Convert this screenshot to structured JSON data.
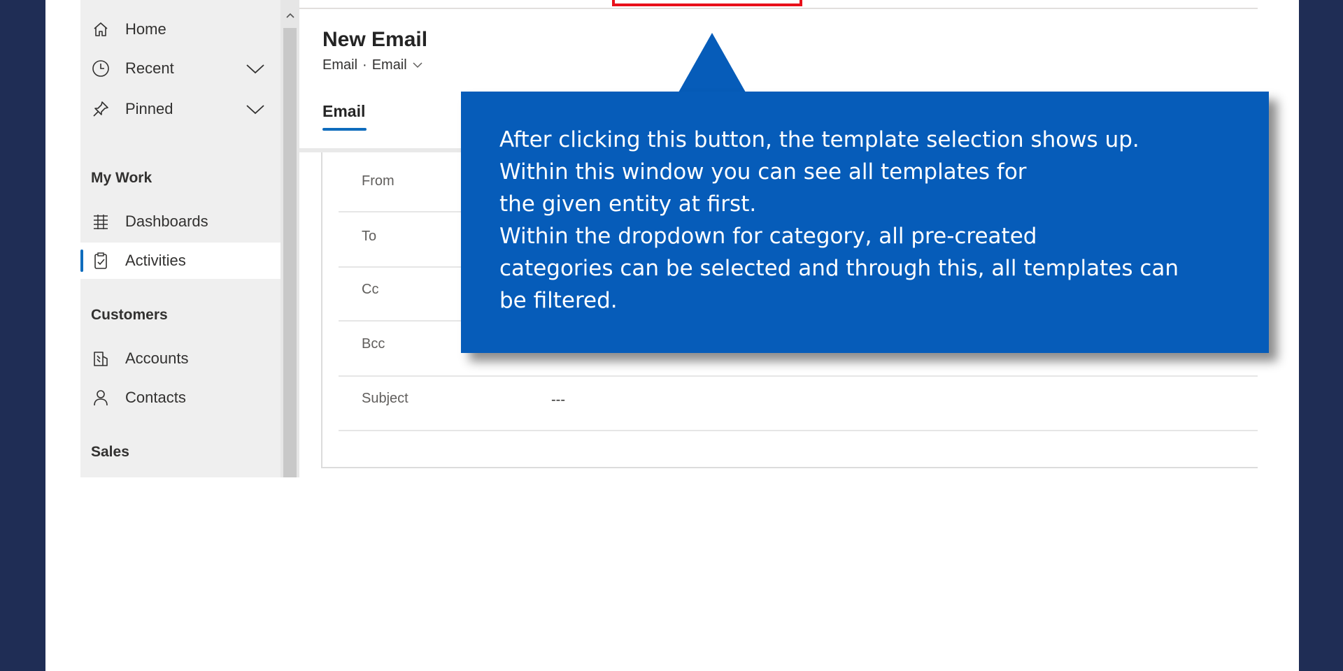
{
  "sidebar": {
    "items": [
      {
        "label": "Home",
        "icon": "home-icon"
      },
      {
        "label": "Recent",
        "icon": "clock-icon"
      },
      {
        "label": "Pinned",
        "icon": "pin-icon"
      }
    ],
    "sections": [
      {
        "title": "My Work",
        "items": [
          {
            "label": "Dashboards",
            "icon": "dashboard-icon"
          },
          {
            "label": "Activities",
            "icon": "clipboard-icon",
            "selected": true
          }
        ]
      },
      {
        "title": "Customers",
        "items": [
          {
            "label": "Accounts",
            "icon": "building-icon"
          },
          {
            "label": "Contacts",
            "icon": "person-icon"
          }
        ]
      },
      {
        "title": "Sales",
        "items": []
      }
    ]
  },
  "record": {
    "title": "New Email",
    "entity": "Email",
    "form": "Email"
  },
  "tabs": [
    {
      "label": "Email",
      "active": true
    }
  ],
  "fields": [
    {
      "label": "From",
      "value": ""
    },
    {
      "label": "To",
      "value": ""
    },
    {
      "label": "Cc",
      "value": ""
    },
    {
      "label": "Bcc",
      "value": ""
    },
    {
      "label": "Subject",
      "value": "---"
    }
  ],
  "callout": {
    "lines": [
      "After clicking this button, the template selection shows up.",
      "Within this window you can see all templates for",
      "the given entity at first.",
      "Within the dropdown for category, all pre-created",
      "categories can be selected and through this, all templates can",
      "be filtered."
    ]
  },
  "colors": {
    "background": "#1f2d55",
    "callout": "#065cb9",
    "accent": "#0f6cbd",
    "highlight": "#e8101a"
  }
}
